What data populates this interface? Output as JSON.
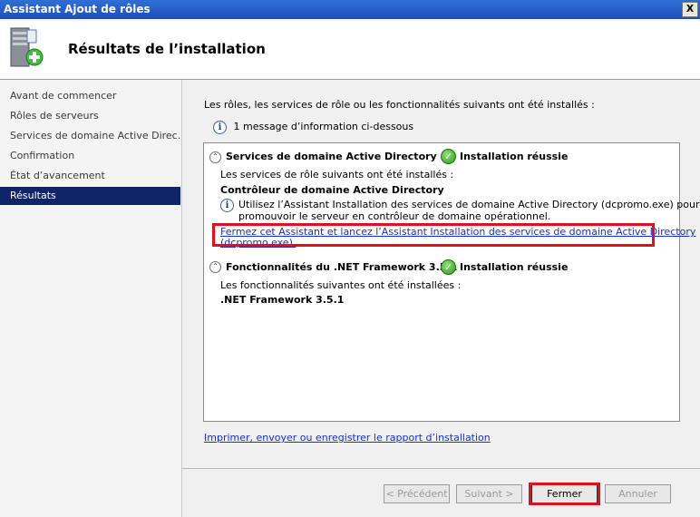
{
  "window": {
    "title": "Assistant Ajout de rôles",
    "close_label": "X"
  },
  "header": {
    "title": "Résultats de l’installation"
  },
  "sidebar": {
    "items": [
      {
        "label": "Avant de commencer"
      },
      {
        "label": "Rôles de serveurs"
      },
      {
        "label": "Services de domaine Active Direc..."
      },
      {
        "label": "Confirmation"
      },
      {
        "label": "État d’avancement"
      },
      {
        "label": "Résultats"
      }
    ],
    "selected": "Résultats"
  },
  "main": {
    "intro": "Les rôles, les services de rôle ou les fonctionnalités suivants ont été installés :",
    "info_message": "1 message d’information ci-dessous",
    "sections": [
      {
        "name": "Services de domaine Active Directory",
        "status": "Installation réussie",
        "subtitle": "Les services de rôle suivants ont été installés :",
        "item": "Contrôleur de domaine Active Directory",
        "info_line1": "Utilisez l’Assistant Installation des services de domaine Active Directory (dcpromo.exe) pour",
        "info_line2": "promouvoir le serveur en contrôleur de domaine opérationnel.",
        "link_line1": "Fermez cet Assistant et lancez l’Assistant Installation des services de domaine Active Directory",
        "link_line2": "(dcpromo.exe)."
      },
      {
        "name": "Fonctionnalités du .NET Framework 3.5.1",
        "status": "Installation réussie",
        "subtitle": "Les fonctionnalités suivantes ont été installées :",
        "item": ".NET Framework 3.5.1"
      }
    ],
    "report_link": "Imprimer, envoyer ou enregistrer le rapport d’installation"
  },
  "buttons": {
    "previous": "< Précédent",
    "next": "Suivant >",
    "close": "Fermer",
    "cancel": "Annuler"
  },
  "colors": {
    "titlebar": "#1d4fb8",
    "selection": "#10246a",
    "link": "#1a2fd0",
    "highlight": "#e01020",
    "success": "#2e9b1e"
  }
}
